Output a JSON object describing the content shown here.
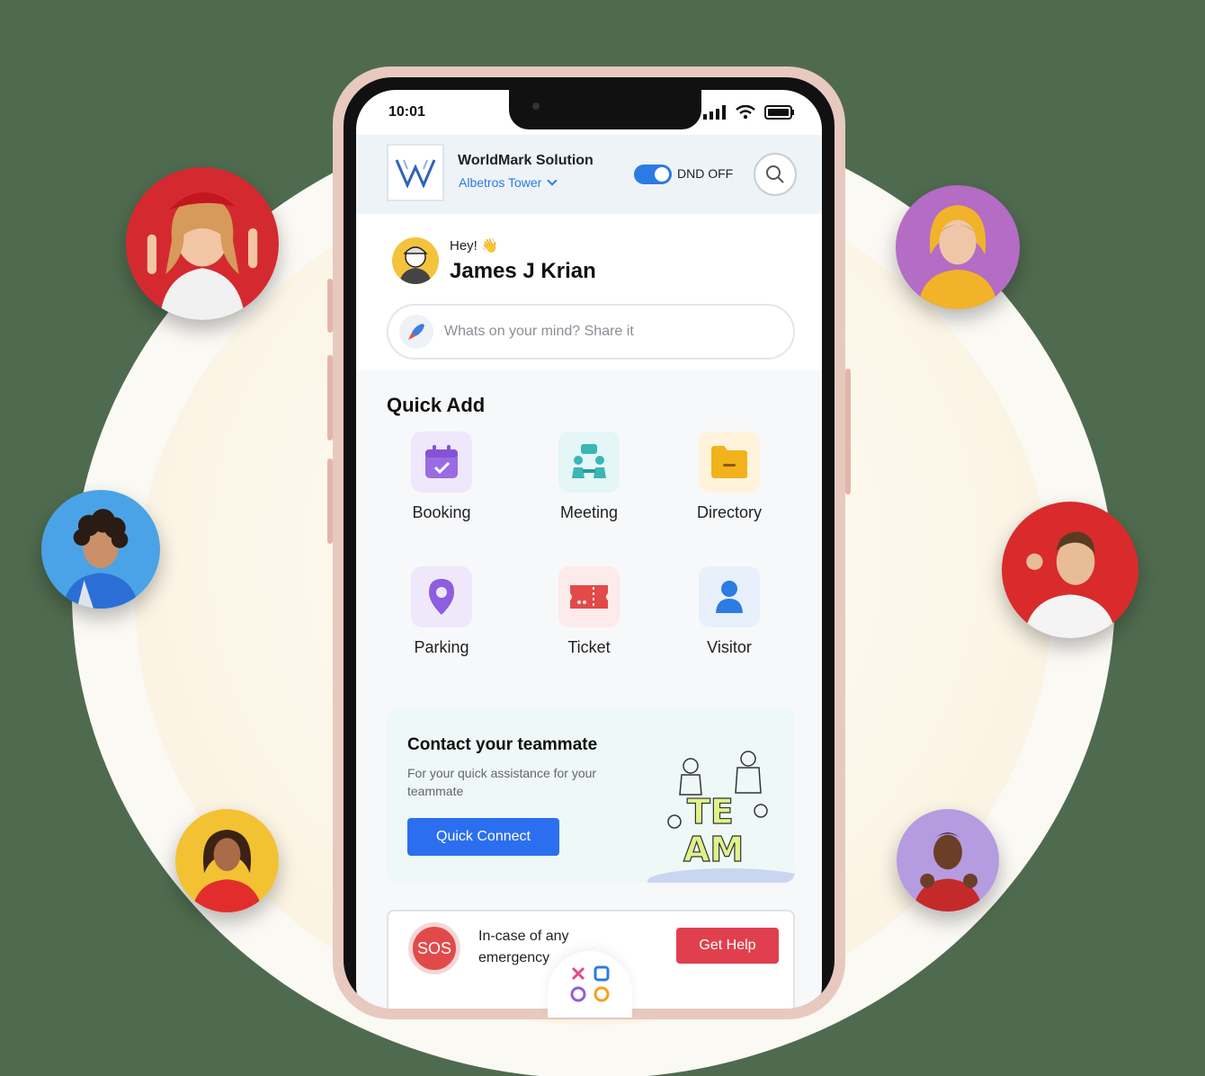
{
  "status_bar": {
    "time": "10:01"
  },
  "header": {
    "org_name": "WorldMark Solution",
    "site_name": "Albetros Tower",
    "dnd_label": "DND OFF",
    "dnd_enabled": true
  },
  "greeting": {
    "hey": "Hey! 👋",
    "user_name": "James J Krian"
  },
  "post": {
    "placeholder": "Whats on your mind? Share it"
  },
  "quick_add": {
    "title": "Quick Add",
    "items": [
      {
        "label": "Booking",
        "icon": "calendar-check-icon",
        "bg": "#efe7fb",
        "color": "#9b6be3"
      },
      {
        "label": "Meeting",
        "icon": "meeting-icon",
        "bg": "#e4f6f6",
        "color": "#3bb5b5"
      },
      {
        "label": "Directory",
        "icon": "folder-icon",
        "bg": "#fff3dc",
        "color": "#f2b21c"
      },
      {
        "label": "Parking",
        "icon": "location-pin-icon",
        "bg": "#efe8fb",
        "color": "#8c5ee0"
      },
      {
        "label": "Ticket",
        "icon": "ticket-icon",
        "bg": "#fdeaea",
        "color": "#e24a4a"
      },
      {
        "label": "Visitor",
        "icon": "person-icon",
        "bg": "#e8f0fc",
        "color": "#2b7be4"
      }
    ]
  },
  "team_card": {
    "title": "Contact your teammate",
    "subtitle": "For your quick assistance for your teammate",
    "button": "Quick Connect",
    "illustration_text_1": "TE",
    "illustration_text_2": "AM"
  },
  "sos_card": {
    "badge": "SOS",
    "text": "In-case of any emergency",
    "button": "Get Help"
  },
  "colors": {
    "accent": "#2b6ff0",
    "danger": "#e0404e"
  }
}
